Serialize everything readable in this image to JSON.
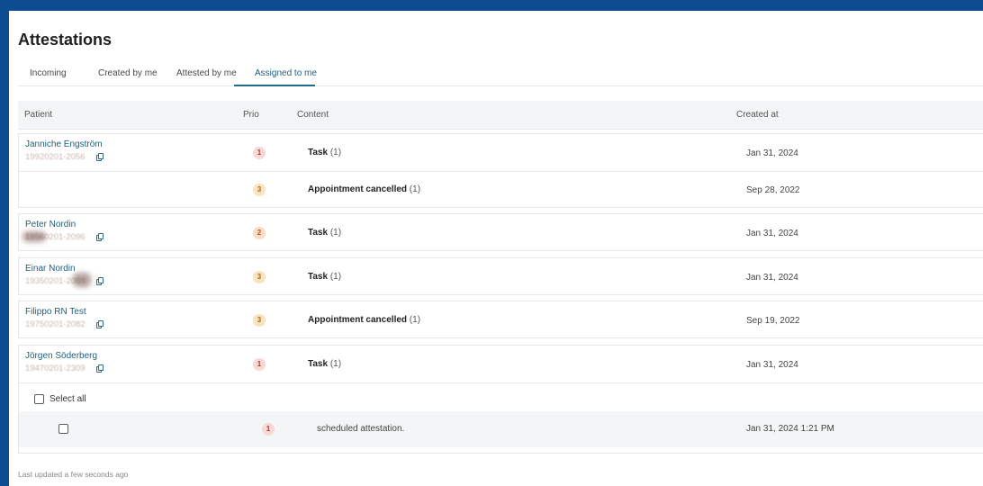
{
  "page": {
    "title": "Attestations"
  },
  "tabs": [
    {
      "label": "Incoming",
      "active": false
    },
    {
      "label": "Created by me",
      "active": false
    },
    {
      "label": "Attested by me",
      "active": false
    },
    {
      "label": "Assigned to me",
      "active": true
    }
  ],
  "table": {
    "columns": {
      "patient": "Patient",
      "prio": "Prio",
      "content": "Content",
      "created_at": "Created at"
    },
    "groups": [
      {
        "patient_name": "Janniche Engström",
        "patient_id": "19920201-2056",
        "rows": [
          {
            "prio": "1",
            "content_type": "Task",
            "content_count": "(1)",
            "created_at": "Jan 31, 2024"
          },
          {
            "prio": "3",
            "content_type": "Appointment cancelled",
            "content_count": "(1)",
            "created_at": "Sep 28, 2022"
          }
        ]
      },
      {
        "patient_name": "Peter Nordin",
        "patient_id": "19560201-2096",
        "rows": [
          {
            "prio": "2",
            "content_type": "Task",
            "content_count": "(1)",
            "created_at": "Jan 31, 2024"
          }
        ]
      },
      {
        "patient_name": "Einar Nordin",
        "patient_id": "19350201-2088",
        "rows": [
          {
            "prio": "3",
            "content_type": "Task",
            "content_count": "(1)",
            "created_at": "Jan 31, 2024"
          }
        ]
      },
      {
        "patient_name": "Filippo RN Test",
        "patient_id": "19750201-2082",
        "rows": [
          {
            "prio": "3",
            "content_type": "Appointment cancelled",
            "content_count": "(1)",
            "created_at": "Sep 19, 2022"
          }
        ]
      },
      {
        "patient_name": "Jörgen Söderberg",
        "patient_id": "19470201-2309",
        "rows": [
          {
            "prio": "1",
            "content_type": "Task",
            "content_count": "(1)",
            "created_at": "Jan 31, 2024"
          }
        ],
        "expanded": {
          "select_all_label": "Select all",
          "items": [
            {
              "prio": "1",
              "text": "scheduled attestation.",
              "created_at": "Jan 31, 2024 1:21 PM"
            }
          ]
        }
      }
    ]
  },
  "footer": {
    "status": "Last updated a few seconds ago"
  },
  "colors": {
    "frame": "#0e4c92",
    "link": "#1f5f7a",
    "prio_1": "#f7d9d7",
    "prio_2": "#f8dcc5",
    "prio_3": "#fae3bf"
  }
}
